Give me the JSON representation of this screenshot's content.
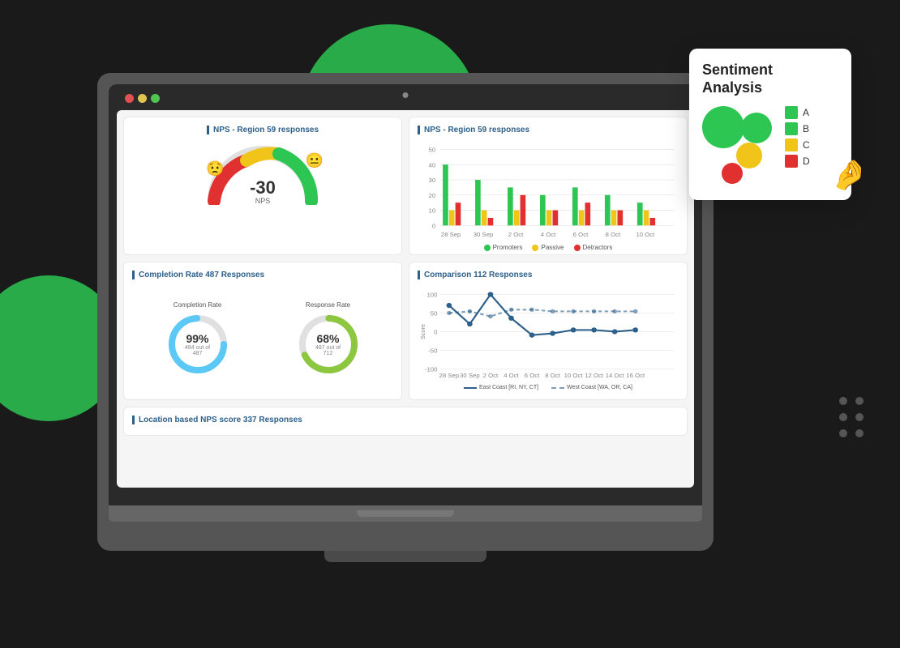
{
  "page": {
    "background": "#1a1a1a"
  },
  "sentiment_card": {
    "title": "Sentiment\nAnalysis",
    "legend": [
      {
        "label": "A",
        "color": "green"
      },
      {
        "label": "B",
        "color": "green"
      },
      {
        "label": "C",
        "color": "yellow"
      },
      {
        "label": "D",
        "color": "red"
      }
    ]
  },
  "panels": {
    "nps_gauge": {
      "title": "NPS - Region 59 responses",
      "value": "-30",
      "label": "NPS"
    },
    "nps_bar": {
      "title": "NPS - Region 59 responses",
      "legend": {
        "promoters": "Promoters",
        "passive": "Passive",
        "detractors": "Detractors"
      }
    },
    "completion": {
      "title": "Completion Rate 487 Responses",
      "completion_rate_label": "Completion Rate",
      "response_rate_label": "Response Rate",
      "completion_pct": "99%",
      "completion_sub": "484 out of 487",
      "response_pct": "68%",
      "response_sub": "487 out of 712"
    },
    "comparison": {
      "title": "Comparison 112 Responses",
      "legend": {
        "east": "East Coast [RI, NY, CT]",
        "west": "West Coast [WA, OR, CA]"
      },
      "y_labels": [
        "100",
        "50",
        "0",
        "-50",
        "-100"
      ],
      "x_labels": [
        "28 Sep",
        "30 Sep",
        "2 Oct",
        "4 Oct",
        "6 Oct",
        "8 Oct",
        "10 Oct",
        "12 Oct",
        "14 Oct",
        "16 Oct"
      ],
      "score_label": "Score"
    },
    "location": {
      "title": "Location based NPS score 337 Responses"
    }
  }
}
